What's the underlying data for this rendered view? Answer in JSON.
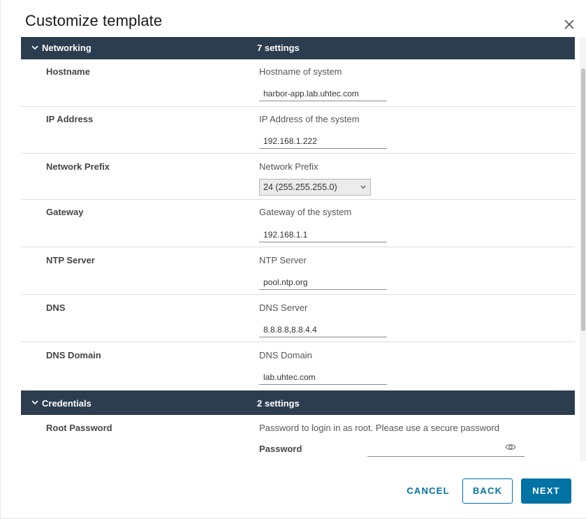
{
  "dialog": {
    "title": "Customize template",
    "close_icon": "close-icon"
  },
  "sections": [
    {
      "title": "Networking",
      "count": "7 settings",
      "rows": [
        {
          "label": "Hostname",
          "description": "Hostname of system",
          "value": "harbor-app.lab.uhtec.com"
        },
        {
          "label": "IP Address",
          "description": "IP Address of the system",
          "value": "192.168.1.222"
        },
        {
          "label": "Network Prefix",
          "description": "Network Prefix",
          "value": "24 (255.255.255.0)"
        },
        {
          "label": "Gateway",
          "description": "Gateway of the system",
          "value": "192.168.1.1"
        },
        {
          "label": "NTP Server",
          "description": "NTP Server",
          "value": "pool.ntp.org"
        },
        {
          "label": "DNS",
          "description": "DNS Server",
          "value": "8.8.8.8,8.8.4.4"
        },
        {
          "label": "DNS Domain",
          "description": "DNS Domain",
          "value": "lab.uhtec.com"
        }
      ]
    },
    {
      "title": "Credentials",
      "count": "2 settings",
      "rows": [
        {
          "label": "Root Password",
          "description": "Password to login in as root. Please use a secure password",
          "field_label": "Password",
          "value": ""
        }
      ]
    }
  ],
  "footer": {
    "cancel_label": "CANCEL",
    "back_label": "BACK",
    "next_label": "NEXT"
  },
  "colors": {
    "section_header_bg": "#2b3d4f",
    "primary": "#0072a3"
  }
}
